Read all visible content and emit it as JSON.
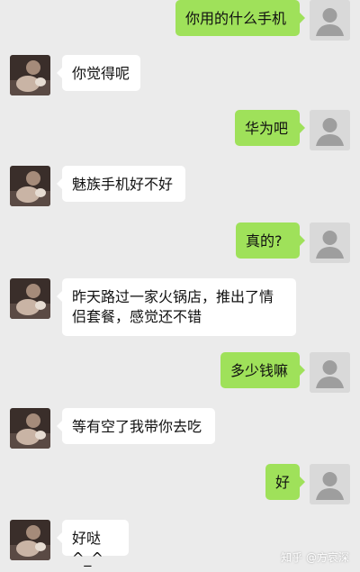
{
  "messages": [
    {
      "side": "right",
      "text": "你用的什么手机"
    },
    {
      "side": "left",
      "text": "你觉得呢"
    },
    {
      "side": "right",
      "text": "华为吧"
    },
    {
      "side": "left",
      "text": "魅族手机好不好"
    },
    {
      "side": "right",
      "text": "真的?"
    },
    {
      "side": "left",
      "text": "昨天路过一家火锅店，推出了情侣套餐，感觉还不错"
    },
    {
      "side": "right",
      "text": "多少钱嘛"
    },
    {
      "side": "left",
      "text": "等有空了我带你去吃"
    },
    {
      "side": "right",
      "text": "好"
    },
    {
      "side": "left",
      "text": "好哒^_^"
    }
  ],
  "watermark": "知乎 @方哀深",
  "colors": {
    "background": "#ebebeb",
    "outgoing_bubble": "#9fe15a",
    "incoming_bubble": "#ffffff"
  },
  "icons": {
    "outgoing_avatar": "default-user-icon",
    "incoming_avatar": "photo-avatar"
  }
}
